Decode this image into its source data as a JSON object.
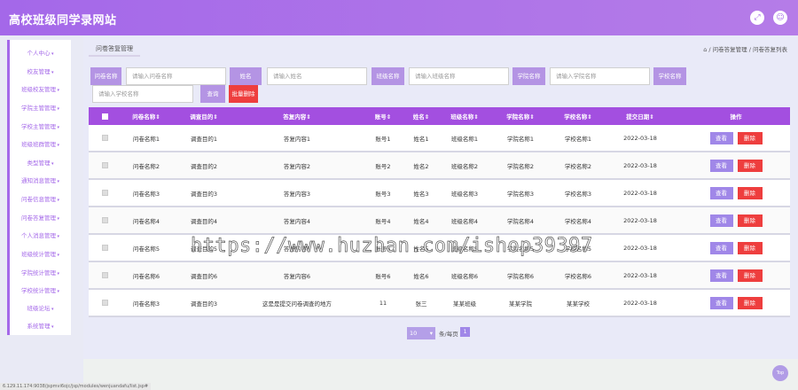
{
  "app": {
    "title": "高校班级同学录网站"
  },
  "sidebar": {
    "items": [
      {
        "label": "个人中心"
      },
      {
        "label": "校友管理"
      },
      {
        "label": "班级校友管理"
      },
      {
        "label": "学院主管管理"
      },
      {
        "label": "学校主管管理"
      },
      {
        "label": "班级班群管理"
      },
      {
        "label": "类型管理"
      },
      {
        "label": "通知消息管理"
      },
      {
        "label": "问卷信息管理"
      },
      {
        "label": "问卷答复管理"
      },
      {
        "label": "个人消息管理"
      },
      {
        "label": "班级统计管理"
      },
      {
        "label": "学院统计管理"
      },
      {
        "label": "学校统计管理"
      },
      {
        "label": "班级论坛"
      },
      {
        "label": "系统管理"
      }
    ]
  },
  "tab": {
    "label": "问卷答复管理"
  },
  "breadcrumb": {
    "text": "⌂ / 问卷答复管理 / 问卷答复列表"
  },
  "search": {
    "f1": {
      "label": "问卷名称",
      "placeholder": "请输入问卷名称"
    },
    "f2": {
      "label": "姓名",
      "placeholder": "请输入姓名"
    },
    "f3": {
      "label": "班级名称",
      "placeholder": "请输入班级名称"
    },
    "f4": {
      "label": "学院名称",
      "placeholder": "请输入学院名称"
    },
    "f5": {
      "label": "学校名称",
      "placeholder": "请输入学校名称"
    },
    "search_label": "查询",
    "batch_delete_label": "批量删除"
  },
  "table": {
    "headers": [
      "问卷名称⇕",
      "调查目的⇕",
      "答复内容⇕",
      "账号⇕",
      "姓名⇕",
      "班级名称⇕",
      "学院名称⇕",
      "学校名称⇕",
      "提交日期⇕",
      "操作"
    ],
    "rows": [
      [
        "问卷名称1",
        "调查目的1",
        "答复内容1",
        "账号1",
        "姓名1",
        "班级名称1",
        "学院名称1",
        "学校名称1",
        "2022-03-18"
      ],
      [
        "问卷名称2",
        "调查目的2",
        "答复内容2",
        "账号2",
        "姓名2",
        "班级名称2",
        "学院名称2",
        "学校名称2",
        "2022-03-18"
      ],
      [
        "问卷名称3",
        "调查目的3",
        "答复内容3",
        "账号3",
        "姓名3",
        "班级名称3",
        "学院名称3",
        "学校名称3",
        "2022-03-18"
      ],
      [
        "问卷名称4",
        "调查目的4",
        "答复内容4",
        "账号4",
        "姓名4",
        "班级名称4",
        "学院名称4",
        "学校名称4",
        "2022-03-18"
      ],
      [
        "问卷名称5",
        "调查目的5",
        "答复内容5",
        "账号5",
        "姓名5",
        "班级名称5",
        "学院名称5",
        "学校名称5",
        "2022-03-18"
      ],
      [
        "问卷名称6",
        "调查目的6",
        "答复内容6",
        "账号6",
        "姓名6",
        "班级名称6",
        "学院名称6",
        "学校名称6",
        "2022-03-18"
      ],
      [
        "问卷名称3",
        "调查目的3",
        "这是是提交问卷调查的地方",
        "11",
        "张三",
        "某某班级",
        "某某学院",
        "某某学校",
        "2022-03-18"
      ]
    ],
    "view_label": "查看",
    "delete_label": "删除"
  },
  "pager": {
    "page_size": "10",
    "per_page_text": "条/每页",
    "current_page": "1"
  },
  "watermark": "https://www.huzhan.com/ishop39397",
  "statusbar": {
    "url": "6.129.11.174:9038/jspmvi6ojc/jsp/modules/wenjuandafu/list.jsp#"
  },
  "top_button": {
    "label": "Top"
  },
  "colors": {
    "accent": "#a468e9",
    "header": "#a34fe0",
    "danger": "#ee3e3e",
    "button": "#a087e8"
  }
}
